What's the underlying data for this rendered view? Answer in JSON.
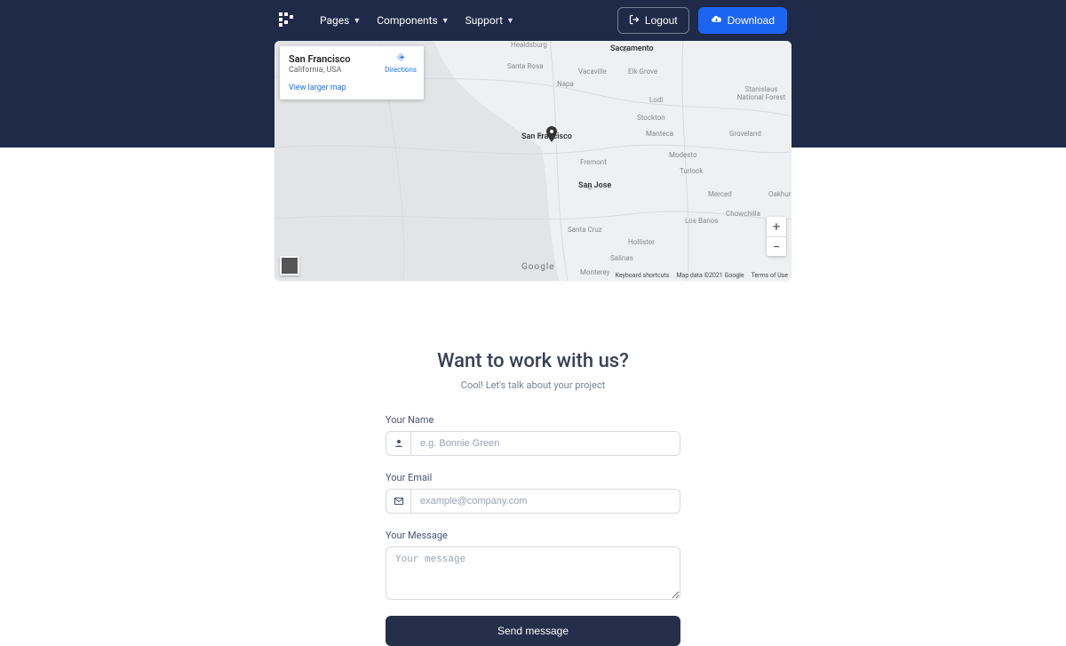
{
  "nav": {
    "items": [
      "Pages",
      "Components",
      "Support"
    ],
    "logout": "Logout",
    "download": "Download"
  },
  "map": {
    "place_title": "San Francisco",
    "place_sub": "California, USA",
    "view_larger": "View larger map",
    "directions": "Directions",
    "zoom_in": "+",
    "zoom_out": "−",
    "google": "Google",
    "credits": [
      "Keyboard shortcuts",
      "Map data ©2021 Google",
      "Terms of Use"
    ],
    "labels": {
      "sacramento": "Sacramento",
      "sanjose": "San Jose",
      "sanfrancisco": "San Francisco",
      "santarosa": "Santa Rosa",
      "vacaville": "Vacaville",
      "napa": "Napa",
      "stockton": "Stockton",
      "modesto": "Modesto",
      "fremont": "Fremont",
      "santacruz": "Santa Cruz",
      "merced": "Merced",
      "turlock": "Turlock",
      "manteca": "Manteca",
      "lodi": "Lodi",
      "elkgrove": "Elk Grove",
      "salinas": "Salinas",
      "monterey": "Monterey",
      "hollister": "Hollister",
      "losbanos": "Los Banos",
      "chowchilla": "Chowchilla",
      "oakhurst": "Oakhurst",
      "groveland": "Groveland",
      "forest": "Stanislaus National Forest",
      "healdsburg": "Healdsburg"
    }
  },
  "contact": {
    "heading": "Want to work with us?",
    "lead": "Cool! Let's talk about your project",
    "name_label": "Your Name",
    "name_ph": "e.g. Bonnie Green",
    "email_label": "Your Email",
    "email_ph": "example@company.com",
    "message_label": "Your Message",
    "message_ph": "Your message",
    "send": "Send message"
  }
}
